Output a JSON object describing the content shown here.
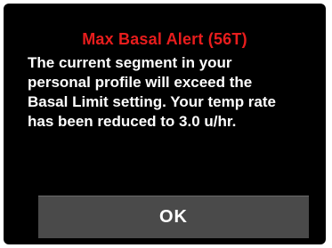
{
  "alert": {
    "title": "Max Basal Alert (56T)",
    "message_lines": [
      "The current segment in your",
      "personal profile will exceed the",
      "Basal Limit setting. Your temp rate",
      "has been reduced to 3.0 u/hr."
    ],
    "ok_label": "OK"
  },
  "colors": {
    "title": "#e81d1d",
    "background": "#000000",
    "text": "#ffffff",
    "button": "#4a4a4a"
  }
}
